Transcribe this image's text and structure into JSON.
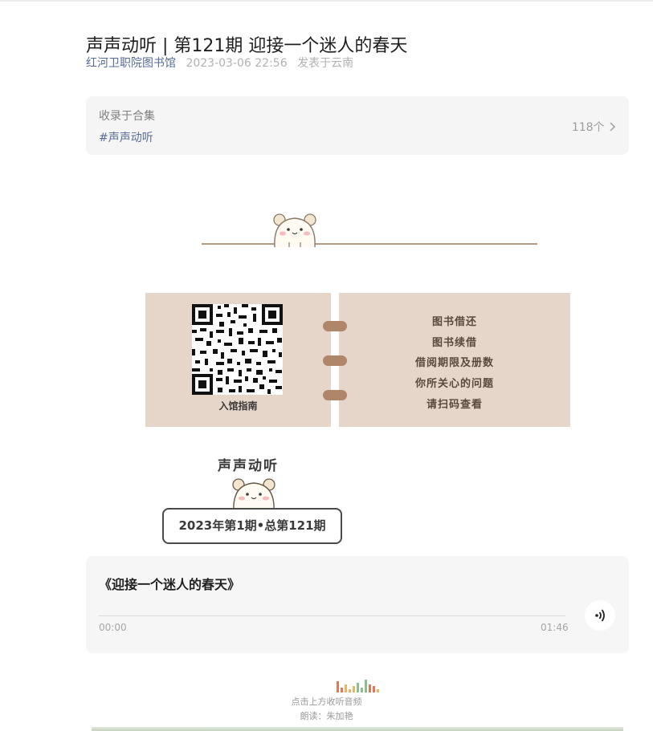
{
  "article": {
    "title": "声声动听 | 第121期 迎接一个迷人的春天",
    "author": "红河卫职院图书馆",
    "datetime": "2023-03-06 22:56",
    "location": "发表于云南"
  },
  "collection": {
    "label": "收录于合集",
    "tag": "#声声动听",
    "count": "118个"
  },
  "guide": {
    "qr_caption": "入馆指南",
    "items": [
      "图书借还",
      "图书续借",
      "借阅期限及册数",
      "你所关心的问题",
      "请扫码查看"
    ]
  },
  "program": {
    "name": "声声动听",
    "issue": "2023年第1期•总第121期"
  },
  "audio": {
    "title": "《迎接一个迷人的春天》",
    "current": "00:00",
    "duration": "01:46",
    "progress": 0
  },
  "footer": {
    "hint": "点击上方收听音频",
    "reader": "朗读：朱加艳"
  },
  "colors": {
    "link": "#576b95",
    "panel": "#e6d6c9",
    "ring": "#b0866b"
  }
}
